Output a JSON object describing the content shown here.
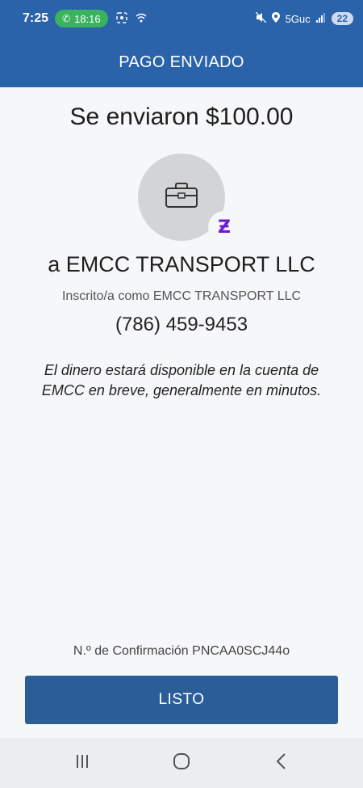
{
  "status_bar": {
    "time": "7:25",
    "call_duration": "18:16",
    "network": "5Guc",
    "battery": "22"
  },
  "header": {
    "title": "PAGO ENVIADO"
  },
  "payment": {
    "amount_text": "Se enviaron $100.00",
    "recipient": "a EMCC TRANSPORT LLC",
    "enrolled_as": "Inscrito/a como EMCC TRANSPORT LLC",
    "phone": "(786) 459-9453",
    "note": "El dinero estará disponible en la cuenta de EMCC en breve, generalmente en minutos.",
    "confirmation": "N.º de Confirmación PNCAA0SCJ44o"
  },
  "actions": {
    "done_label": "LISTO"
  },
  "icons": {
    "avatar": "briefcase-icon",
    "badge": "zelle-icon",
    "badge_glyph": "Ƶ",
    "badge_color": "#6c1cd3"
  },
  "colors": {
    "primary": "#2b63ab",
    "button": "#2b5e99",
    "background": "#f6f7f9"
  }
}
